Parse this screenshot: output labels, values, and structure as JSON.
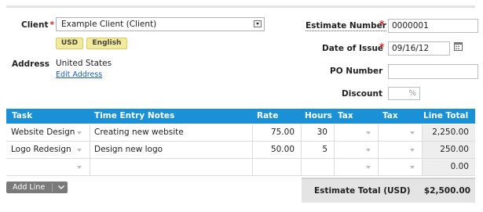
{
  "header": {
    "client_label": "Client",
    "client_value": "Example Client (Client)",
    "currency_badge": "USD",
    "language_badge": "English",
    "address_label": "Address",
    "address_value": "United States",
    "edit_address_link": "Edit Address",
    "estimate_number_label": "Estimate Number",
    "estimate_number_value": "0000001",
    "date_of_issue_label": "Date of Issue",
    "date_of_issue_value": "09/16/12",
    "po_number_label": "PO Number",
    "po_number_value": "",
    "discount_label": "Discount",
    "discount_value": "",
    "discount_unit": "%"
  },
  "table": {
    "columns": [
      "Task",
      "Time Entry Notes",
      "Rate",
      "Hours",
      "Tax",
      "Tax",
      "Line Total"
    ],
    "rows": [
      {
        "task": "Website Design",
        "notes": "Creating new website",
        "rate": "75.00",
        "hours": "30",
        "tax1": "",
        "tax2": "",
        "line_total": "2,250.00"
      },
      {
        "task": "Logo Redesign",
        "notes": "Design new logo",
        "rate": "50.00",
        "hours": "5",
        "tax1": "",
        "tax2": "",
        "line_total": "250.00"
      },
      {
        "task": "",
        "notes": "",
        "rate": "",
        "hours": "",
        "tax1": "",
        "tax2": "",
        "line_total": "0.00"
      }
    ]
  },
  "footer": {
    "add_line_label": "Add Line",
    "estimate_total_label": "Estimate Total (USD)",
    "estimate_total_value": "$2,500.00"
  },
  "colors": {
    "table_header": "#1a90d6",
    "required_marker": "#dd2222",
    "badge_background": "#f1ea9a",
    "link": "#1a5fb4"
  }
}
